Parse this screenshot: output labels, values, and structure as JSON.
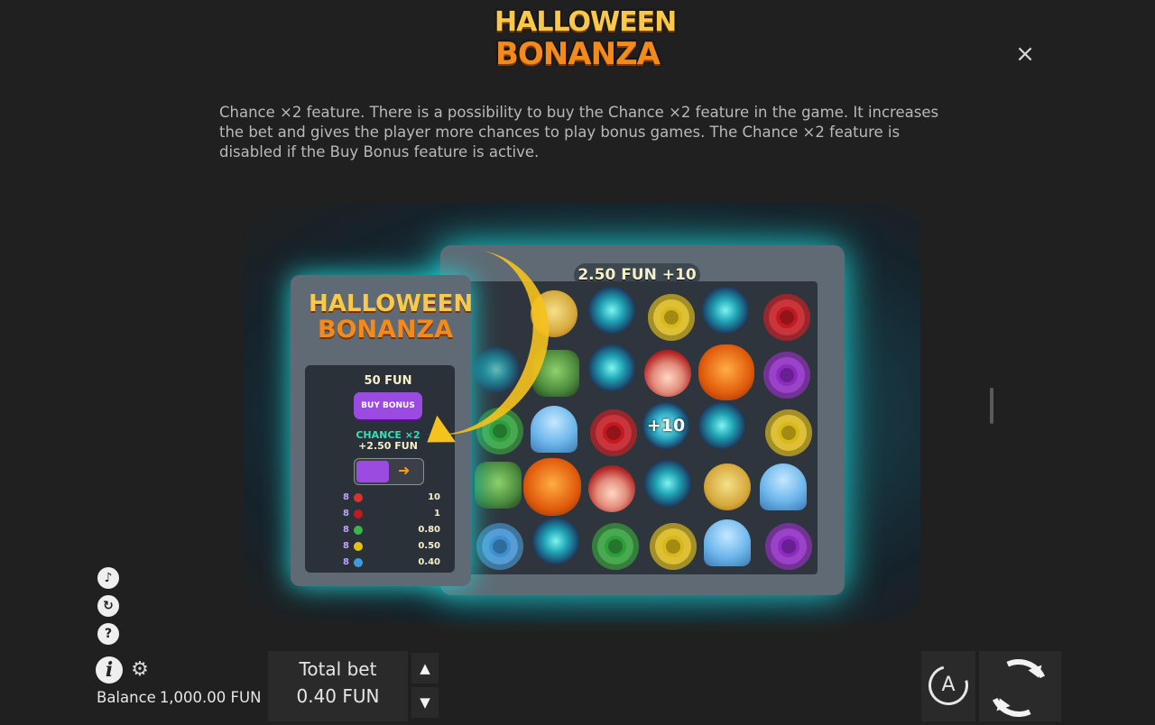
{
  "header": {
    "logo_line1": "HALLOWEEN",
    "logo_line2": "BONANZA",
    "close_label": "×"
  },
  "content": {
    "description": "Chance ×2 feature. There is a possibility to buy the Chance ×2 feature in the game. It increases the bet and gives the player more chances to play bonus games. The Chance ×2 feature is disabled if the Buy Bonus feature is active."
  },
  "preview": {
    "logo_line1": "HALLOWEEN",
    "logo_line2": "BONANZA",
    "bet_banner": "2.50 FUN +10",
    "buy_price": "50 FUN",
    "buy_label": "BUY BONUS",
    "chance_label": "CHANCE ×2",
    "chance_price": "+2.50 FUN",
    "multiplier_symbol": "+10",
    "paytable": [
      {
        "count": "8",
        "color": "#d9342b",
        "value": "10"
      },
      {
        "count": "8",
        "color": "#c0191f",
        "value": "1"
      },
      {
        "count": "8",
        "color": "#39b54a",
        "value": "0.80"
      },
      {
        "count": "8",
        "color": "#e2c21a",
        "value": "0.50"
      },
      {
        "count": "8",
        "color": "#3f9be0",
        "value": "0.40"
      }
    ]
  },
  "controls": {
    "balance_label": "Balance",
    "balance_value": "1,000.00 FUN",
    "total_bet_label": "Total bet",
    "total_bet_value": "0.40 FUN",
    "bet_up": "▲",
    "bet_down": "▼",
    "auto_letter": "A",
    "icons": {
      "sound": "sound-icon",
      "history": "history-icon",
      "help": "?",
      "info": "i",
      "settings": "⚙"
    }
  },
  "colors": {
    "background": "#202020",
    "accent_teal": "#1ed6d6",
    "accent_purple": "#9b4be0",
    "accent_orange": "#f28a1c"
  }
}
